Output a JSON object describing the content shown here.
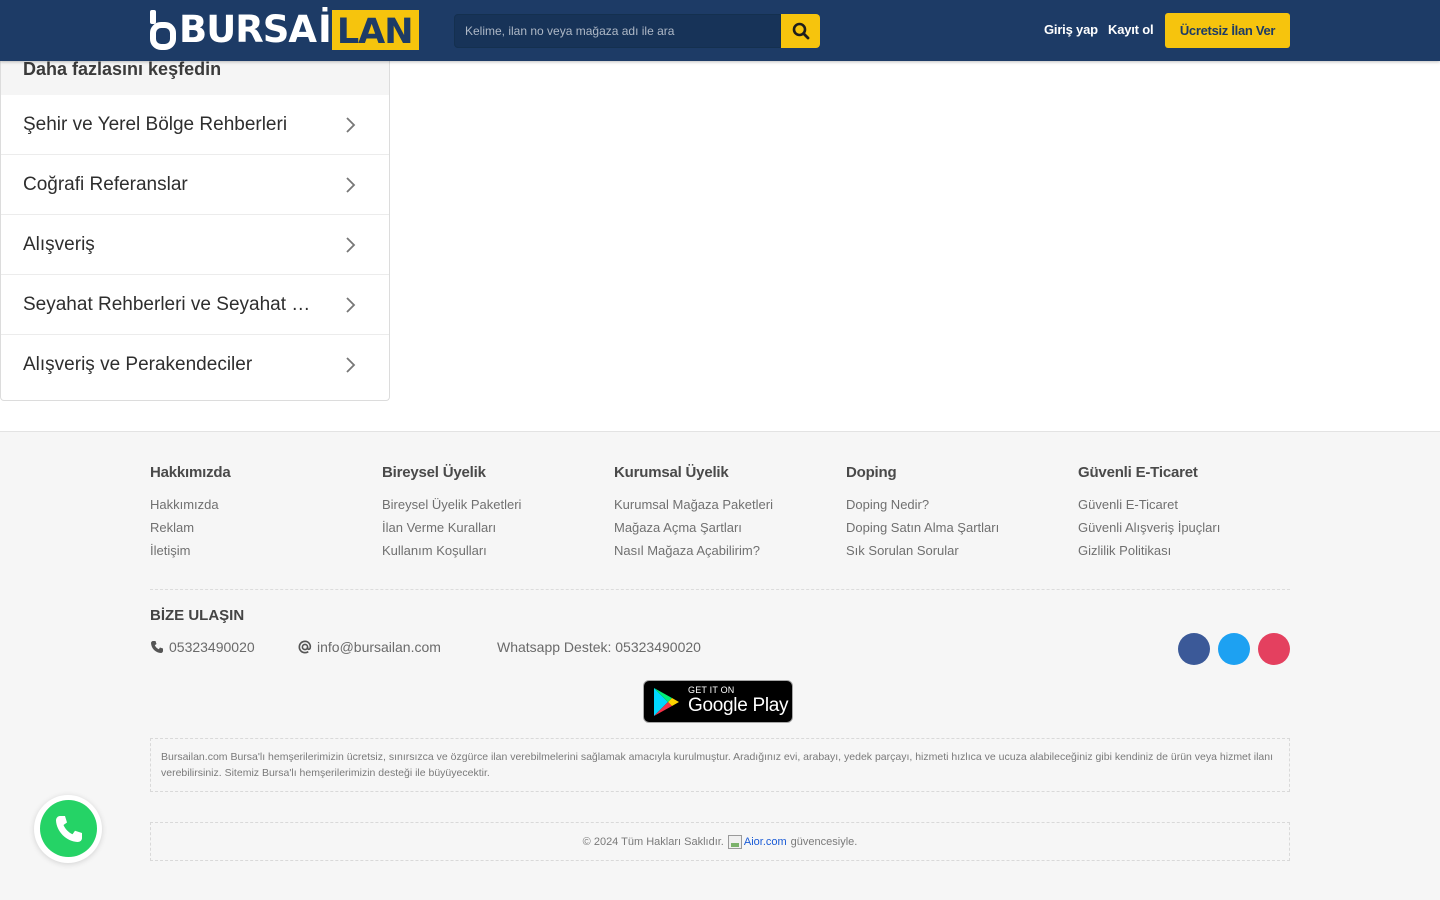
{
  "header": {
    "logo": {
      "left": "BURSA",
      "i": "İ",
      "right": "LAN"
    },
    "search": {
      "placeholder": "Kelime, ilan no veya mağaza adı ile ara",
      "icon": "search-icon"
    },
    "login_label": "Giriş yap",
    "register_label": "Kayıt ol",
    "cta_label": "Ücretsiz İlan Ver",
    "colors": {
      "bg": "#1d3b66",
      "accent": "#f6c40d"
    }
  },
  "panel": {
    "title": "Daha fazlasını keşfedin",
    "items": [
      {
        "label": "Şehir ve Yerel Bölge Rehberleri"
      },
      {
        "label": "Coğrafi Referanslar"
      },
      {
        "label": "Alışveriş"
      },
      {
        "label": "Seyahat Rehberleri ve Seyahat Günl..."
      },
      {
        "label": "Alışveriş ve Perakendeciler"
      }
    ]
  },
  "footer": {
    "columns": [
      {
        "title": "Hakkımızda",
        "links": [
          "Hakkımızda",
          "Reklam",
          "İletişim"
        ]
      },
      {
        "title": "Bireysel Üyelik",
        "links": [
          "Bireysel Üyelik Paketleri",
          "İlan Verme Kuralları",
          "Kullanım Koşulları"
        ]
      },
      {
        "title": "Kurumsal Üyelik",
        "links": [
          "Kurumsal Mağaza Paketleri",
          "Mağaza Açma Şartları",
          "Nasıl Mağaza Açabilirim?"
        ]
      },
      {
        "title": "Doping",
        "links": [
          "Doping Nedir?",
          "Doping Satın Alma Şartları",
          "Sık Sorulan Sorular"
        ]
      },
      {
        "title": "Güvenli E-Ticaret",
        "links": [
          "Güvenli E-Ticaret",
          "Güvenli Alışveriş İpuçları",
          "Gizlilik Politikası"
        ]
      }
    ],
    "contact": {
      "title": "BİZE ULAŞIN",
      "phone": "05323490020",
      "email": "info@bursailan.com",
      "whatsapp": "Whatsapp Destek: 05323490020"
    },
    "social": [
      {
        "name": "facebook-icon",
        "color": "#3b5998"
      },
      {
        "name": "twitter-icon",
        "color": "#1da1f2"
      },
      {
        "name": "instagram-icon",
        "color": "#e4405f"
      }
    ],
    "google_play": {
      "small": "GET IT ON",
      "big": "Google Play"
    },
    "about": "Bursailan.com Bursa'lı hemşerilerimizin ücretsiz, sınırsızca ve özgürce ilan verebilmelerini sağlamak amacıyla kurulmuştur. Aradığınız evi, arabayı, yedek parçayı, hizmeti hızlıca ve ucuza alabileceğiniz gibi kendiniz de ürün veya hizmet ilanı verebilirsiniz. Sitemiz Bursa'lı hemşerilerimizin desteği ile büyüyecektir.",
    "copyright": "© 2024 Tüm Hakları Saklıdır.",
    "aior_alt": "Aior.com",
    "guvence": "güvencesiyle."
  }
}
